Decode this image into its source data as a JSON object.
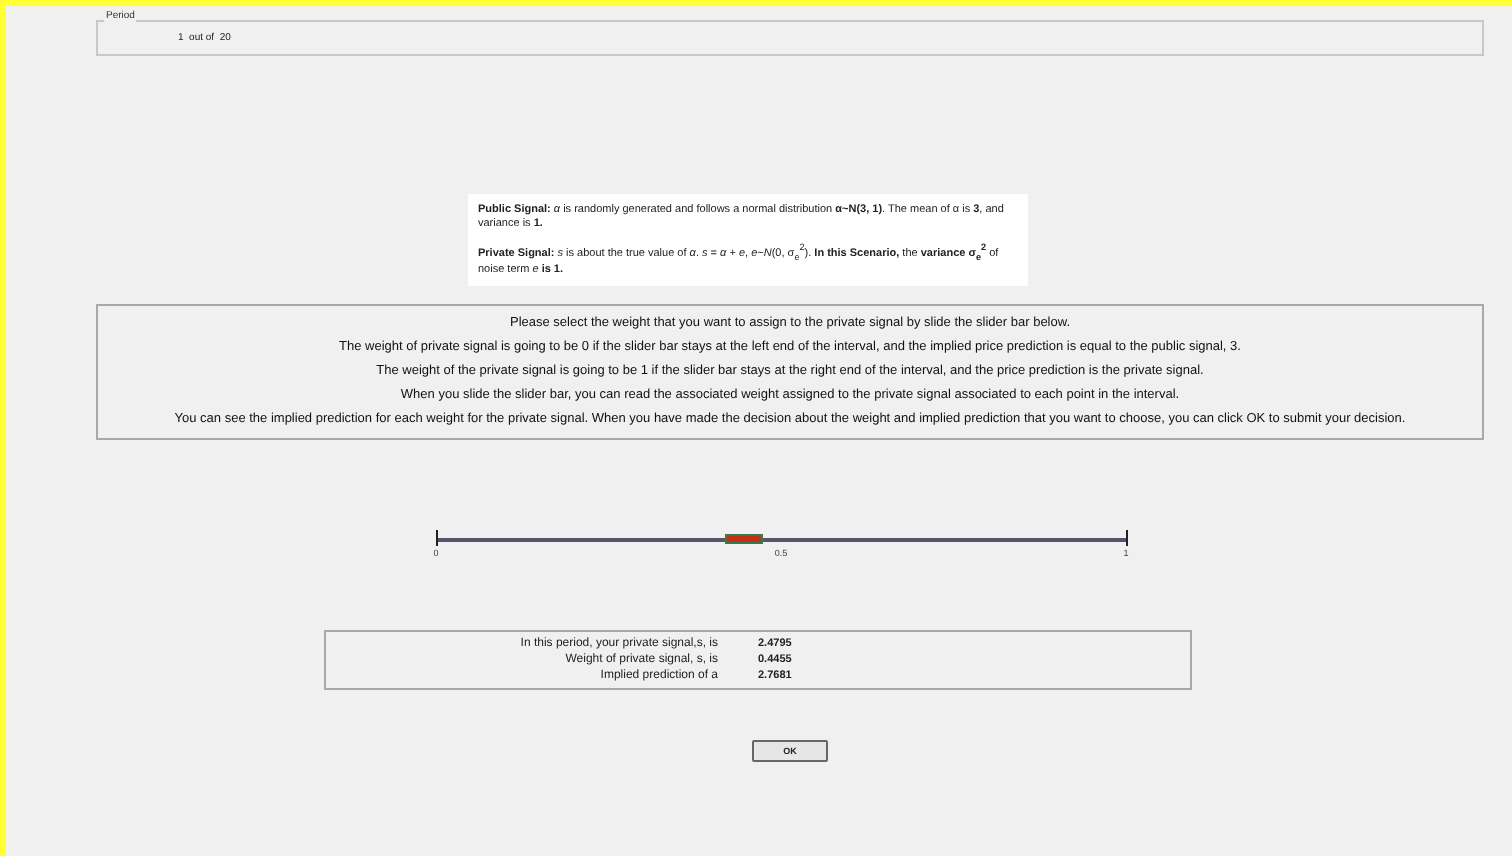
{
  "period": {
    "legend": "Period",
    "value": "1  out of  20"
  },
  "signals": [
    "**Public Signal:** *α* is randomly generated and follows a normal distribution **α~N(3, 1)**. The mean of α is **3**, and variance is **1.**",
    "**Private Signal:** *s* is about the true value of *α*.  *s* = *α* + *e*, *e*~*N*(0, σ$_{e}$$^{2}$). **In this Scenario,** the **variance σ$_{e}$$^{2}$** of noise term *e* **is 1.**"
  ],
  "instructions": [
    "Please select the weight that you want to assign to the private signal by slide the slider bar below.",
    "The weight of private signal is going to be 0 if the slider bar stays at the left end of the interval, and the implied price prediction is equal to the public signal, 3.",
    "The weight of the private signal is going to be 1 if the slider bar stays at the right end of the interval, and the price prediction is the private signal.",
    "When you slide the slider bar, you can read the associated weight assigned to the private signal associated to each point in the interval.",
    "You can see the implied prediction for each weight for the private signal. When you have made the decision about the weight and implied prediction that you want to choose, you can click OK to submit your decision."
  ],
  "slider": {
    "level": 0.4455,
    "ticks": [
      "0",
      "0.5",
      "1"
    ]
  },
  "results": [
    {
      "label": "In this period, your private signal,s, is",
      "value": "2.4795"
    },
    {
      "label": "Weight of private signal, s, is",
      "value": "0.4455"
    },
    {
      "label": "Implied prediction of a",
      "value": "2.7681"
    }
  ],
  "ok_button": "OK"
}
